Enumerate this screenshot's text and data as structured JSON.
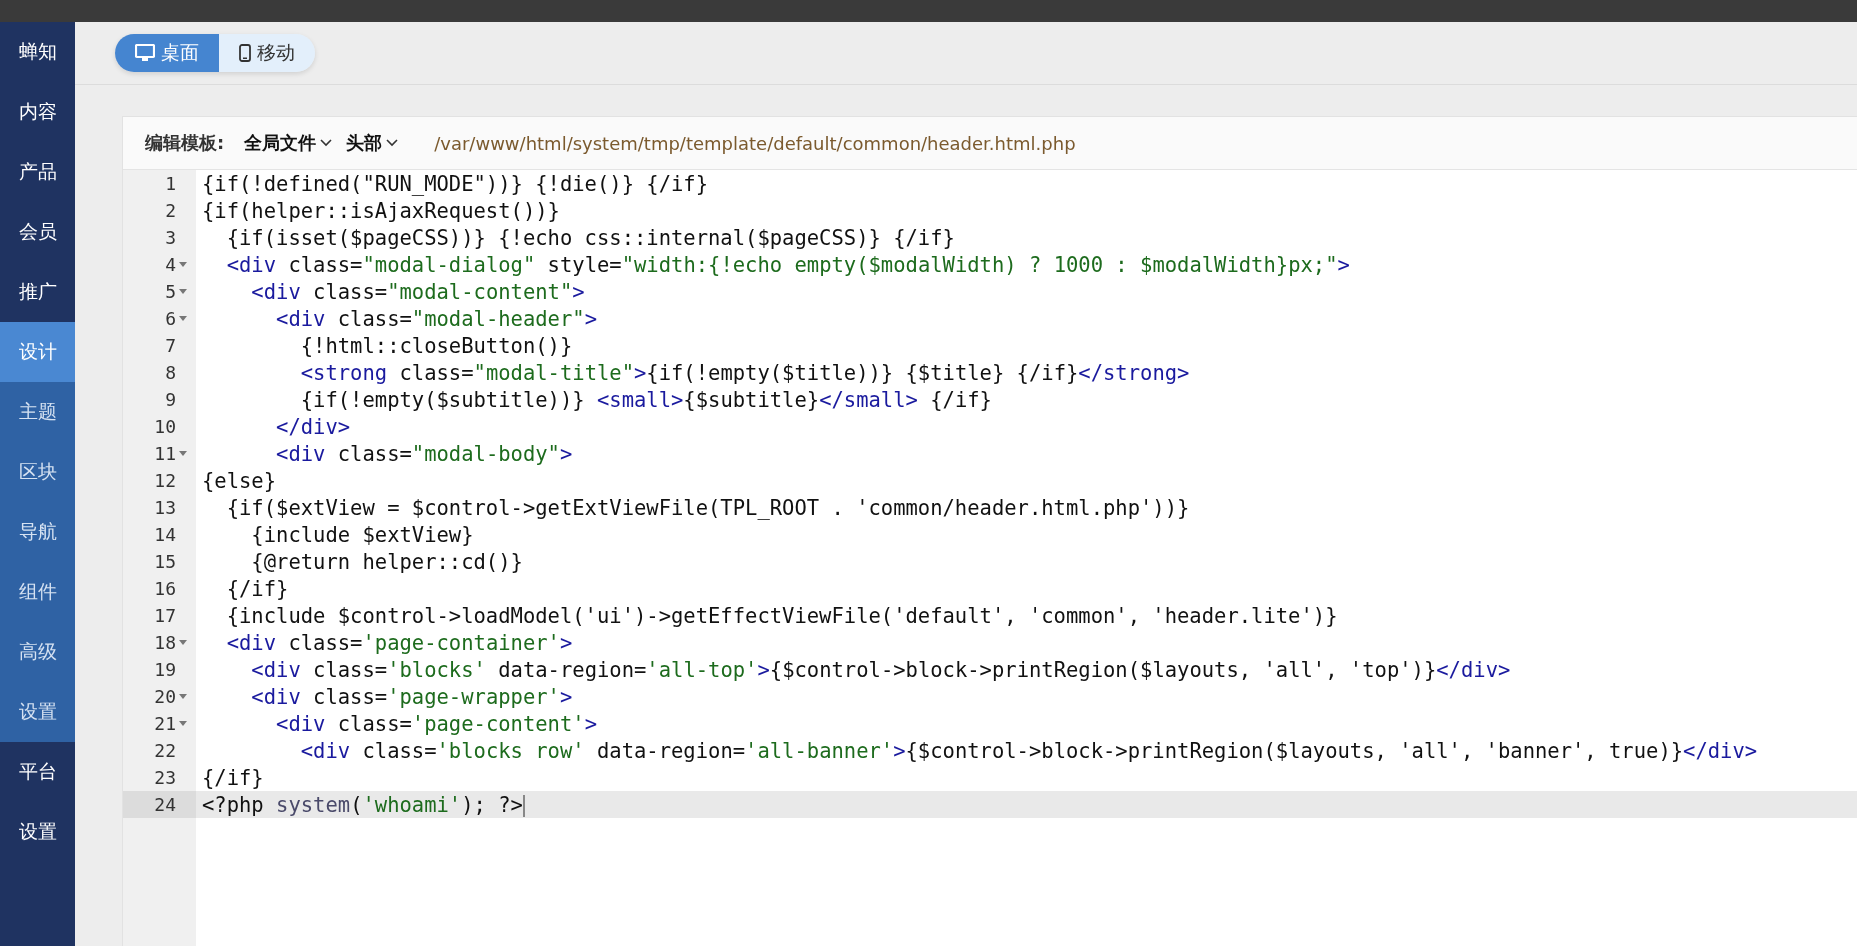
{
  "sidebar": {
    "items": [
      {
        "label": "蝉知",
        "kind": "main",
        "selected": false
      },
      {
        "label": "内容",
        "kind": "main",
        "selected": false
      },
      {
        "label": "产品",
        "kind": "main",
        "selected": false
      },
      {
        "label": "会员",
        "kind": "main",
        "selected": false
      },
      {
        "label": "推广",
        "kind": "main",
        "selected": false
      },
      {
        "label": "设计",
        "kind": "sub",
        "selected": true
      },
      {
        "label": "主题",
        "kind": "sub",
        "selected": false
      },
      {
        "label": "区块",
        "kind": "sub",
        "selected": false
      },
      {
        "label": "导航",
        "kind": "sub",
        "selected": false
      },
      {
        "label": "组件",
        "kind": "sub",
        "selected": false
      },
      {
        "label": "高级",
        "kind": "sub",
        "selected": false
      },
      {
        "label": "设置",
        "kind": "sub",
        "selected": false
      },
      {
        "label": "平台",
        "kind": "main",
        "selected": false
      },
      {
        "label": "设置",
        "kind": "main",
        "selected": false
      }
    ]
  },
  "view_toggle": [
    {
      "label": "桌面",
      "kind": "desktop",
      "selected": true
    },
    {
      "label": "移动",
      "kind": "mobile",
      "selected": false
    }
  ],
  "editor": {
    "label": "编辑模板:",
    "dropdowns": [
      "全局文件",
      "头部"
    ],
    "path": "/var/www/html/system/tmp/template/default/common/header.html.php",
    "lines": [
      {
        "number": "1",
        "foldable": false,
        "selected": false,
        "tokens": [
          {
            "kind": "plain",
            "text": "{if(!defined(\"RUN_MODE\"))} {!die()} {/if}"
          }
        ]
      },
      {
        "number": "2",
        "foldable": false,
        "selected": false,
        "tokens": [
          {
            "kind": "plain",
            "text": "{if(helper::isAjaxRequest())}"
          }
        ]
      },
      {
        "number": "3",
        "foldable": false,
        "selected": false,
        "tokens": [
          {
            "kind": "plain",
            "text": "  {if(isset($pageCSS))} {!echo css::internal($pageCSS)} {/if}"
          }
        ]
      },
      {
        "number": "4",
        "foldable": true,
        "selected": false,
        "tokens": [
          {
            "kind": "tag",
            "text": "  <div"
          },
          {
            "kind": "plain",
            "text": " class="
          },
          {
            "kind": "string",
            "text": "\"modal-dialog\""
          },
          {
            "kind": "plain",
            "text": " style="
          },
          {
            "kind": "string",
            "text": "\"width:{!echo empty($modalWidth) ? 1000 : $modalWidth}px;\""
          },
          {
            "kind": "tag",
            "text": ">"
          }
        ]
      },
      {
        "number": "5",
        "foldable": true,
        "selected": false,
        "tokens": [
          {
            "kind": "tag",
            "text": "    <div"
          },
          {
            "kind": "plain",
            "text": " class="
          },
          {
            "kind": "string",
            "text": "\"modal-content\""
          },
          {
            "kind": "tag",
            "text": ">"
          }
        ]
      },
      {
        "number": "6",
        "foldable": true,
        "selected": false,
        "tokens": [
          {
            "kind": "tag",
            "text": "      <div"
          },
          {
            "kind": "plain",
            "text": " class="
          },
          {
            "kind": "string",
            "text": "\"modal-header\""
          },
          {
            "kind": "tag",
            "text": ">"
          }
        ]
      },
      {
        "number": "7",
        "foldable": false,
        "selected": false,
        "tokens": [
          {
            "kind": "plain",
            "text": "        {!html::closeButton()}"
          }
        ]
      },
      {
        "number": "8",
        "foldable": false,
        "selected": false,
        "tokens": [
          {
            "kind": "tag",
            "text": "        <strong"
          },
          {
            "kind": "plain",
            "text": " class="
          },
          {
            "kind": "string",
            "text": "\"modal-title\""
          },
          {
            "kind": "tag",
            "text": ">"
          },
          {
            "kind": "plain",
            "text": "{if(!empty($title))} {$title} {/if}"
          },
          {
            "kind": "tag",
            "text": "</strong>"
          }
        ]
      },
      {
        "number": "9",
        "foldable": false,
        "selected": false,
        "tokens": [
          {
            "kind": "plain",
            "text": "        {if(!empty($subtitle))} "
          },
          {
            "kind": "tag",
            "text": "<small>"
          },
          {
            "kind": "plain",
            "text": "{$subtitle}"
          },
          {
            "kind": "tag",
            "text": "</small>"
          },
          {
            "kind": "plain",
            "text": " {/if}"
          }
        ]
      },
      {
        "number": "10",
        "foldable": false,
        "selected": false,
        "tokens": [
          {
            "kind": "tag",
            "text": "      </div>"
          }
        ]
      },
      {
        "number": "11",
        "foldable": true,
        "selected": false,
        "tokens": [
          {
            "kind": "tag",
            "text": "      <div"
          },
          {
            "kind": "plain",
            "text": " class="
          },
          {
            "kind": "string",
            "text": "\"modal-body\""
          },
          {
            "kind": "tag",
            "text": ">"
          }
        ]
      },
      {
        "number": "12",
        "foldable": false,
        "selected": false,
        "tokens": [
          {
            "kind": "plain",
            "text": "{else}"
          }
        ]
      },
      {
        "number": "13",
        "foldable": false,
        "selected": false,
        "tokens": [
          {
            "kind": "plain",
            "text": "  {if($extView = $control->getExtViewFile(TPL_ROOT . 'common/header.html.php'))}"
          }
        ]
      },
      {
        "number": "14",
        "foldable": false,
        "selected": false,
        "tokens": [
          {
            "kind": "plain",
            "text": "    {include $extView}"
          }
        ]
      },
      {
        "number": "15",
        "foldable": false,
        "selected": false,
        "tokens": [
          {
            "kind": "plain",
            "text": "    {@return helper::cd()}"
          }
        ]
      },
      {
        "number": "16",
        "foldable": false,
        "selected": false,
        "tokens": [
          {
            "kind": "plain",
            "text": "  {/if}"
          }
        ]
      },
      {
        "number": "17",
        "foldable": false,
        "selected": false,
        "tokens": [
          {
            "kind": "plain",
            "text": "  {include $control->loadModel('ui')->getEffectViewFile('default', 'common', 'header.lite')}"
          }
        ]
      },
      {
        "number": "18",
        "foldable": true,
        "selected": false,
        "tokens": [
          {
            "kind": "tag",
            "text": "  <div"
          },
          {
            "kind": "plain",
            "text": " class="
          },
          {
            "kind": "string",
            "text": "'page-container'"
          },
          {
            "kind": "tag",
            "text": ">"
          }
        ]
      },
      {
        "number": "19",
        "foldable": false,
        "selected": false,
        "tokens": [
          {
            "kind": "tag",
            "text": "    <div"
          },
          {
            "kind": "plain",
            "text": " class="
          },
          {
            "kind": "string",
            "text": "'blocks'"
          },
          {
            "kind": "plain",
            "text": " data-region="
          },
          {
            "kind": "string",
            "text": "'all-top'"
          },
          {
            "kind": "tag",
            "text": ">"
          },
          {
            "kind": "plain",
            "text": "{$control->block->printRegion($layouts, 'all', 'top')}"
          },
          {
            "kind": "tag",
            "text": "</div>"
          }
        ]
      },
      {
        "number": "20",
        "foldable": true,
        "selected": false,
        "tokens": [
          {
            "kind": "tag",
            "text": "    <div"
          },
          {
            "kind": "plain",
            "text": " class="
          },
          {
            "kind": "string",
            "text": "'page-wrapper'"
          },
          {
            "kind": "tag",
            "text": ">"
          }
        ]
      },
      {
        "number": "21",
        "foldable": true,
        "selected": false,
        "tokens": [
          {
            "kind": "tag",
            "text": "      <div"
          },
          {
            "kind": "plain",
            "text": " class="
          },
          {
            "kind": "string",
            "text": "'page-content'"
          },
          {
            "kind": "tag",
            "text": ">"
          }
        ]
      },
      {
        "number": "22",
        "foldable": false,
        "selected": false,
        "tokens": [
          {
            "kind": "tag",
            "text": "        <div"
          },
          {
            "kind": "plain",
            "text": " class="
          },
          {
            "kind": "string",
            "text": "'blocks row'"
          },
          {
            "kind": "plain",
            "text": " data-region="
          },
          {
            "kind": "string",
            "text": "'all-banner'"
          },
          {
            "kind": "tag",
            "text": ">"
          },
          {
            "kind": "plain",
            "text": "{$control->block->printRegion($layouts, 'all', 'banner', true)}"
          },
          {
            "kind": "tag",
            "text": "</div>"
          }
        ]
      },
      {
        "number": "23",
        "foldable": false,
        "selected": false,
        "tokens": [
          {
            "kind": "plain",
            "text": "{/if}"
          }
        ]
      },
      {
        "number": "24",
        "foldable": false,
        "selected": true,
        "tokens": [
          {
            "kind": "plain",
            "text": "<?php "
          },
          {
            "kind": "function",
            "text": "system"
          },
          {
            "kind": "plain",
            "text": "("
          },
          {
            "kind": "string",
            "text": "'whoami'"
          },
          {
            "kind": "plain",
            "text": "); ?>"
          }
        ]
      }
    ]
  }
}
